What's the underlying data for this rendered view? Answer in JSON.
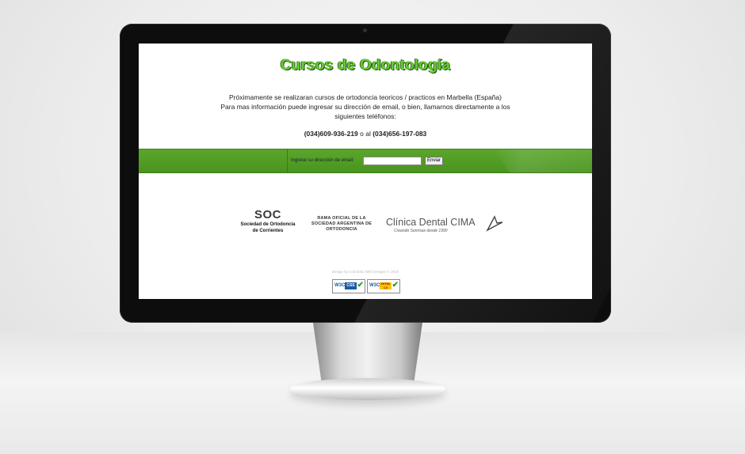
{
  "page": {
    "title": "Cursos de Odontología",
    "intro_lines": [
      "Próximamente se realizaran cursos de ortodoncia teoricos / practicos en Marbella (España)",
      "Para mas información puede ingresar su dirección de email, o bien, llamarnos directamente a los",
      "siguientes teléfonos:"
    ],
    "phone_1": "(034)609-936-219",
    "phone_separator": " o al ",
    "phone_2": "(034)656-197-083"
  },
  "signup": {
    "label": "Ingrese su dirección de email:",
    "email_value": "",
    "button_label": "Enviar"
  },
  "logos": {
    "soc": {
      "abbr": "SOC",
      "line1": "Sociedad de Ortodoncia",
      "line2": "de Corrientes"
    },
    "rama": {
      "line1": "RAMA OFICIAL DE LA",
      "line2": "SOCIEDAD ARGENTINA DE",
      "line3": "ORTODONCIA"
    },
    "cima": {
      "name": "Clínica Dental CIMA",
      "tagline": "Creando Sonrisas desde 1990"
    }
  },
  "footer": {
    "credit": "Design by Cobramix Web Designs © 2010",
    "badge_css": {
      "w3c": "W3C",
      "kind": "CSS"
    },
    "badge_xhtml": {
      "w3c": "W3C",
      "kind": "XHTML 1.0"
    }
  },
  "colors": {
    "title_green": "#66cc33",
    "bar_green": "#4f9a24"
  }
}
